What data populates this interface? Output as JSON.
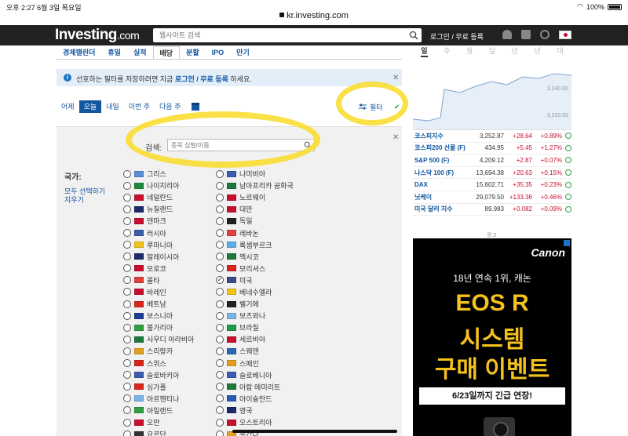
{
  "status": {
    "time": "오후 2:27",
    "date": "6월 3일 목요일",
    "url": "kr.investing.com",
    "battery": "100%"
  },
  "header": {
    "logo": "Investing",
    "logo_suffix": ".com",
    "search_placeholder": "웹사이트 검색",
    "login": "로그인 / 무료 등록"
  },
  "nav": {
    "items": [
      {
        "label": "경제캘린더",
        "active": false
      },
      {
        "label": "휴일",
        "active": false
      },
      {
        "label": "실적",
        "active": false
      },
      {
        "label": "배당",
        "active": true
      },
      {
        "label": "분할",
        "active": false
      },
      {
        "label": "IPO",
        "active": false
      },
      {
        "label": "만기",
        "active": false
      }
    ]
  },
  "notice": {
    "before": "선호하는 필터를 저장하려면 지금 ",
    "link": "로그인 / 무료 등록",
    "after": " 하세요."
  },
  "dates": {
    "items": [
      {
        "label": "어제",
        "active": false
      },
      {
        "label": "오늘",
        "active": true
      },
      {
        "label": "내일",
        "active": false
      },
      {
        "label": "이번 주",
        "active": false
      },
      {
        "label": "다음 주",
        "active": false
      }
    ],
    "filter_label": "필터"
  },
  "filter": {
    "search_label": "검색:",
    "search_placeholder": "종목 심벌/이름",
    "country_label": "국가:",
    "select_all": "모두 선택하기",
    "clear": "지우기",
    "col1": [
      {
        "name": "그리스",
        "flag": "#5b8fd6",
        "checked": false
      },
      {
        "name": "나이지리아",
        "flag": "#1e8a3c",
        "checked": false
      },
      {
        "name": "네덜란드",
        "flag": "#c8102e",
        "checked": false
      },
      {
        "name": "뉴질랜드",
        "flag": "#1b2a6b",
        "checked": false
      },
      {
        "name": "덴마크",
        "flag": "#c8102e",
        "checked": false
      },
      {
        "name": "러시아",
        "flag": "#3a5dae",
        "checked": false
      },
      {
        "name": "루마니아",
        "flag": "#f0c419",
        "checked": false
      },
      {
        "name": "말레이시아",
        "flag": "#1b2a6b",
        "checked": false
      },
      {
        "name": "모로코",
        "flag": "#c8102e",
        "checked": false
      },
      {
        "name": "몰타",
        "flag": "#e04040",
        "checked": false
      },
      {
        "name": "바레인",
        "flag": "#c8102e",
        "checked": false
      },
      {
        "name": "베트남",
        "flag": "#d8261e",
        "checked": false
      },
      {
        "name": "보스니아",
        "flag": "#1b3f95",
        "checked": false
      },
      {
        "name": "불가리아",
        "flag": "#2f9e44",
        "checked": false
      },
      {
        "name": "사우디 아라비아",
        "flag": "#1e7a3c",
        "checked": false
      },
      {
        "name": "스리랑카",
        "flag": "#e0a020",
        "checked": false
      },
      {
        "name": "스위스",
        "flag": "#d8261e",
        "checked": false
      },
      {
        "name": "슬로바키아",
        "flag": "#3a5dae",
        "checked": false
      },
      {
        "name": "싱가폴",
        "flag": "#d8261e",
        "checked": false
      },
      {
        "name": "아르헨티나",
        "flag": "#7ab5e6",
        "checked": false
      },
      {
        "name": "아일랜드",
        "flag": "#2f9e44",
        "checked": false
      },
      {
        "name": "오만",
        "flag": "#c8102e",
        "checked": false
      },
      {
        "name": "요르단",
        "flag": "#333333",
        "checked": false
      }
    ],
    "col2": [
      {
        "name": "나미비아",
        "flag": "#3a5dae",
        "checked": false
      },
      {
        "name": "남아프리카 공화국",
        "flag": "#1e7a3c",
        "checked": false
      },
      {
        "name": "노르웨이",
        "flag": "#c8102e",
        "checked": false
      },
      {
        "name": "대만",
        "flag": "#c8102e",
        "checked": false
      },
      {
        "name": "독일",
        "flag": "#222222",
        "checked": false
      },
      {
        "name": "레바논",
        "flag": "#e04040",
        "checked": false
      },
      {
        "name": "룩셈부르크",
        "flag": "#5ab0e6",
        "checked": false
      },
      {
        "name": "멕시코",
        "flag": "#1e7a3c",
        "checked": false
      },
      {
        "name": "모리셔스",
        "flag": "#d8261e",
        "checked": false
      },
      {
        "name": "미국",
        "flag": "#3a4a8a",
        "checked": true
      },
      {
        "name": "베네수엘라",
        "flag": "#f0c419",
        "checked": false
      },
      {
        "name": "벨기에",
        "flag": "#222222",
        "checked": false
      },
      {
        "name": "보츠와나",
        "flag": "#7ab5e6",
        "checked": false
      },
      {
        "name": "브라질",
        "flag": "#1e9a4c",
        "checked": false
      },
      {
        "name": "세르비아",
        "flag": "#c8102e",
        "checked": false
      },
      {
        "name": "스웨덴",
        "flag": "#2a6ab5",
        "checked": false
      },
      {
        "name": "스페인",
        "flag": "#e0a020",
        "checked": false
      },
      {
        "name": "슬로베니아",
        "flag": "#3a5dae",
        "checked": false
      },
      {
        "name": "아랍 에미리트",
        "flag": "#1e7a3c",
        "checked": false
      },
      {
        "name": "아이슬란드",
        "flag": "#2a5ab5",
        "checked": false
      },
      {
        "name": "영국",
        "flag": "#1b2a6b",
        "checked": false
      },
      {
        "name": "오스트리아",
        "flag": "#c8102e",
        "checked": false
      },
      {
        "name": "우간다",
        "flag": "#e0a020",
        "checked": false
      }
    ]
  },
  "right": {
    "tabs": [
      "일",
      "주",
      "월",
      "달",
      "년",
      "년",
      "대"
    ],
    "chart_labels": [
      "3,240.00",
      "3,220.00"
    ],
    "quotes": [
      {
        "name": "코스피지수",
        "value": "3,252.87",
        "change": "+28.64",
        "pct": "+0.89%"
      },
      {
        "name": "코스피200 선물 (F)",
        "value": "434.95",
        "change": "+5.45",
        "pct": "+1.27%"
      },
      {
        "name": "S&P 500 (F)",
        "value": "4,209.12",
        "change": "+2.87",
        "pct": "+0.07%"
      },
      {
        "name": "나스닥 100 (F)",
        "value": "13,694.38",
        "change": "+20.63",
        "pct": "+0.15%"
      },
      {
        "name": "DAX",
        "value": "15,602.71",
        "change": "+35.35",
        "pct": "+0.23%"
      },
      {
        "name": "닛케이",
        "value": "29,079.50",
        "change": "+133.36",
        "pct": "+0.46%"
      },
      {
        "name": "미국 달러 지수",
        "value": "89.983",
        "change": "+0.082",
        "pct": "+0.09%"
      }
    ],
    "ad_label": "광고",
    "ad": {
      "brand": "Canon",
      "line1": "18년 연속 1위, 캐논",
      "line2": "EOS R",
      "line3": "시스템",
      "line4": "구매 이벤트",
      "banner": "6/23일까지 긴급 연장!"
    }
  }
}
